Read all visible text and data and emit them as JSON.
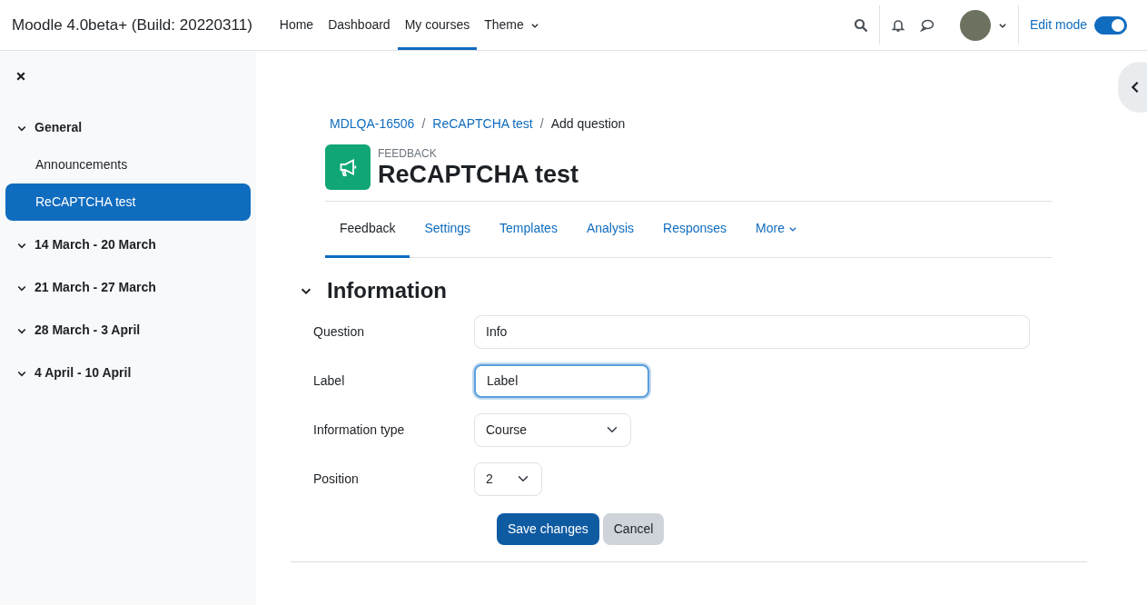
{
  "navbar": {
    "site_name": "Moodle 4.0beta+ (Build: 20220311)",
    "nav_items": [
      {
        "label": "Home",
        "selected": false,
        "kind": "link"
      },
      {
        "label": "Dashboard",
        "selected": false,
        "kind": "link"
      },
      {
        "label": "My courses",
        "selected": true,
        "kind": "link"
      },
      {
        "label": "Theme",
        "selected": false,
        "kind": "dropdown"
      }
    ],
    "edit_mode": {
      "label": "Edit mode",
      "on": true
    }
  },
  "drawer": {
    "sections": [
      {
        "label": "General",
        "expanded": true,
        "children": [
          {
            "label": "Announcements",
            "selected": false
          },
          {
            "label": "ReCAPTCHA test",
            "selected": true
          }
        ]
      },
      {
        "label": "14 March - 20 March",
        "expanded": true
      },
      {
        "label": "21 March - 27 March",
        "expanded": true
      },
      {
        "label": "28 March - 3 April",
        "expanded": true
      },
      {
        "label": "4 April - 10 April",
        "expanded": true
      }
    ]
  },
  "breadcrumb": {
    "separator": "/",
    "items": [
      {
        "label": "MDLQA-16506",
        "kind": "link"
      },
      {
        "label": "ReCAPTCHA test",
        "kind": "link"
      },
      {
        "label": "Add question",
        "kind": "current"
      }
    ]
  },
  "header": {
    "module_type": "FEEDBACK",
    "title": "ReCAPTCHA test"
  },
  "tabs": [
    {
      "label": "Feedback",
      "selected": true,
      "kind": "link"
    },
    {
      "label": "Settings",
      "selected": false,
      "kind": "link"
    },
    {
      "label": "Templates",
      "selected": false,
      "kind": "link"
    },
    {
      "label": "Analysis",
      "selected": false,
      "kind": "link"
    },
    {
      "label": "Responses",
      "selected": false,
      "kind": "link"
    },
    {
      "label": "More",
      "selected": false,
      "kind": "dropdown"
    }
  ],
  "section": {
    "title": "Information",
    "expanded": true
  },
  "fields": [
    {
      "kind": "text",
      "label": "Question",
      "value": "Info",
      "focused": false
    },
    {
      "kind": "text",
      "label": "Label",
      "value": "Label",
      "focused": true
    },
    {
      "kind": "select",
      "label": "Information type",
      "value": "Course",
      "focused": false
    },
    {
      "kind": "select",
      "label": "Position",
      "value": "2",
      "focused": false
    }
  ],
  "buttons": [
    {
      "label": "Save changes",
      "kind": "primary"
    },
    {
      "label": "Cancel",
      "kind": "secondary"
    }
  ]
}
